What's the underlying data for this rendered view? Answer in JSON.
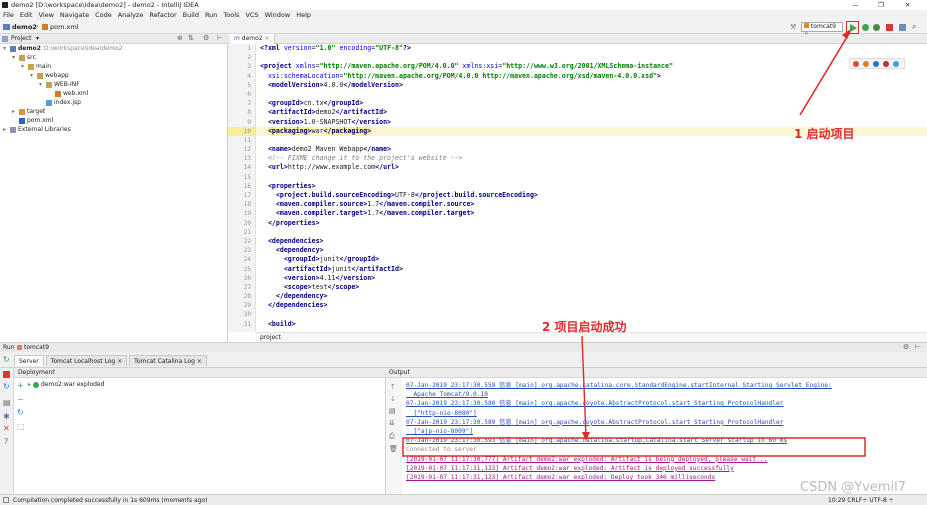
{
  "window": {
    "title": "demo2 [D:\\workspace\\idea\\demo2] - demo2 - IntelliJ IDEA",
    "controls": [
      "—",
      "❐",
      "✕"
    ]
  },
  "menu": [
    "File",
    "Edit",
    "View",
    "Navigate",
    "Code",
    "Analyze",
    "Refactor",
    "Build",
    "Run",
    "Tools",
    "VCS",
    "Window",
    "Help"
  ],
  "nav": {
    "crumbs": [
      "demo2",
      "pom.xml"
    ],
    "run_config": "tomcat9"
  },
  "project": {
    "header": "Project",
    "tree": [
      {
        "label": "demo2",
        "path": "D:\\workspace\\idea\\demo2",
        "indent": 0,
        "kind": "module",
        "open": true
      },
      {
        "label": "src",
        "indent": 1,
        "kind": "folder",
        "open": true
      },
      {
        "label": "main",
        "indent": 2,
        "kind": "folder",
        "open": true
      },
      {
        "label": "webapp",
        "indent": 3,
        "kind": "folder",
        "open": true
      },
      {
        "label": "WEB-INF",
        "indent": 4,
        "kind": "folder",
        "open": true
      },
      {
        "label": "web.xml",
        "indent": 5,
        "kind": "xml"
      },
      {
        "label": "index.jsp",
        "indent": 4,
        "kind": "jsp"
      },
      {
        "label": "target",
        "indent": 1,
        "kind": "target",
        "open": false
      },
      {
        "label": "pom.xml",
        "indent": 1,
        "kind": "pom"
      },
      {
        "label": "External Libraries",
        "indent": 0,
        "kind": "lib",
        "open": false
      }
    ]
  },
  "editor": {
    "tab": "demo2",
    "breadcrumb": "project",
    "lines": [
      {
        "n": "1",
        "html": "<span class='tag'>&lt;?xml </span><span class='attr'>version</span>=<span class='val'>\"1.0\"</span> <span class='attr'>encoding</span>=<span class='val'>\"UTF-8\"</span><span class='tag'>?&gt;</span>"
      },
      {
        "n": "2",
        "html": ""
      },
      {
        "n": "3",
        "html": "<span class='tag'>&lt;project </span><span class='attr'>xmlns</span>=<span class='val'>\"http://maven.apache.org/POM/4.0.0\"</span> <span class='attr'>xmlns:xsi</span>=<span class='val'>\"http://www.w3.org/2001/XMLSchema-instance\"</span>"
      },
      {
        "n": "4",
        "html": "  <span class='attr'>xsi:schemaLocation</span>=<span class='val'>\"http://maven.apache.org/POM/4.0.0 http://maven.apache.org/xsd/maven-4.0.0.xsd\"</span><span class='tag'>&gt;</span>"
      },
      {
        "n": "5",
        "html": "  <span class='tag'>&lt;modelVersion&gt;</span>4.0.0<span class='tag'>&lt;/modelVersion&gt;</span>"
      },
      {
        "n": "6",
        "html": ""
      },
      {
        "n": "7",
        "html": "  <span class='tag'>&lt;groupId&gt;</span>cn.tx<span class='tag'>&lt;/groupId&gt;</span>"
      },
      {
        "n": "8",
        "html": "  <span class='tag'>&lt;artifactId&gt;</span>demo2<span class='tag'>&lt;/artifactId&gt;</span>"
      },
      {
        "n": "9",
        "html": "  <span class='tag'>&lt;version&gt;</span>1.0-SNAPSHOT<span class='tag'>&lt;/version&gt;</span>"
      },
      {
        "n": "10",
        "html": "  <span class='tag hl'>&lt;packaging&gt;</span>war<span class='tag hl'>&lt;/packaging&gt;</span>",
        "hl": true
      },
      {
        "n": "11",
        "html": ""
      },
      {
        "n": "12",
        "html": "  <span class='tag'>&lt;name&gt;</span>demo2 Maven Webapp<span class='tag'>&lt;/name&gt;</span>"
      },
      {
        "n": "13",
        "html": "  <span class='cm'>&lt;!-- FIXME change it to the project's website --&gt;</span>"
      },
      {
        "n": "14",
        "html": "  <span class='tag'>&lt;url&gt;</span>http://www.example.com<span class='tag'>&lt;/url&gt;</span>"
      },
      {
        "n": "15",
        "html": ""
      },
      {
        "n": "16",
        "html": "  <span class='tag'>&lt;properties&gt;</span>"
      },
      {
        "n": "17",
        "html": "    <span class='tag'>&lt;project.build.sourceEncoding&gt;</span>UTF-8<span class='tag'>&lt;/project.build.sourceEncoding&gt;</span>"
      },
      {
        "n": "18",
        "html": "    <span class='tag'>&lt;maven.compiler.source&gt;</span>1.7<span class='tag'>&lt;/maven.compiler.source&gt;</span>"
      },
      {
        "n": "19",
        "html": "    <span class='tag'>&lt;maven.compiler.target&gt;</span>1.7<span class='tag'>&lt;/maven.compiler.target&gt;</span>"
      },
      {
        "n": "20",
        "html": "  <span class='tag'>&lt;/properties&gt;</span>"
      },
      {
        "n": "21",
        "html": ""
      },
      {
        "n": "22",
        "html": "  <span class='tag'>&lt;dependencies&gt;</span>"
      },
      {
        "n": "23",
        "html": "    <span class='tag'>&lt;dependency&gt;</span>"
      },
      {
        "n": "24",
        "html": "      <span class='tag'>&lt;groupId&gt;</span>junit<span class='tag'>&lt;/groupId&gt;</span>"
      },
      {
        "n": "25",
        "html": "      <span class='tag'>&lt;artifactId&gt;</span>junit<span class='tag'>&lt;/artifactId&gt;</span>"
      },
      {
        "n": "26",
        "html": "      <span class='tag'>&lt;version&gt;</span>4.11<span class='tag'>&lt;/version&gt;</span>"
      },
      {
        "n": "27",
        "html": "      <span class='tag'>&lt;scope&gt;</span>test<span class='tag'>&lt;/scope&gt;</span>"
      },
      {
        "n": "28",
        "html": "    <span class='tag'>&lt;/dependency&gt;</span>"
      },
      {
        "n": "29",
        "html": "  <span class='tag'>&lt;/dependencies&gt;</span>"
      },
      {
        "n": "30",
        "html": ""
      },
      {
        "n": "31",
        "html": "  <span class='tag'>&lt;build&gt;</span>"
      }
    ]
  },
  "run": {
    "title": "Run",
    "config": "tomcat9",
    "tabs": [
      "Server",
      "Tomcat Localhost Log",
      "Tomcat Catalina Log"
    ],
    "deployment_header": "Deployment",
    "deployment_item": "demo2:war exploded",
    "output_header": "Output",
    "log": [
      {
        "t": "07-Jan-2019 23:17:30.559 信息 [main] org.apache.catalina.core.StandardEngine.startInternal Starting Servlet Engine:",
        "c": "blue"
      },
      {
        "t": "  Apache Tomcat/9.0.10",
        "c": "blue"
      },
      {
        "t": "07-Jan-2019 23:17:30.580 信息 [main] org.apache.coyote.AbstractProtocol.start Starting ProtocolHandler",
        "c": "blue"
      },
      {
        "t": "  [\"http-nio-8080\"]",
        "c": "blue"
      },
      {
        "t": "07-Jan-2019 23:17:30.589 信息 [main] org.apache.coyote.AbstractProtocol.start Starting ProtocolHandler",
        "c": "blue"
      },
      {
        "t": "  [\"ajp-nio-8009\"]",
        "c": "blue"
      },
      {
        "t": "07-Jan-2019 23:17:30.593 信息 [main] org.apache.catalina.startup.Catalina.start Server startup in 60 ms",
        "c": "blue"
      },
      {
        "t": "Connected to server",
        "c": "grey"
      },
      {
        "t": "[2019-01-07 11:17:30,777] Artifact demo2:war exploded: Artifact is being deployed, please wait...",
        "c": "mag"
      },
      {
        "t": "[2019-01-07 11:17:31,123] Artifact demo2:war exploded: Artifact is deployed successfully",
        "c": "mag"
      },
      {
        "t": "[2019-01-07 11:17:31,123] Artifact demo2:war exploded: Deploy took 346 milliseconds",
        "c": "mag"
      }
    ]
  },
  "status": {
    "message": "Compilation completed successfully in 1s 609ms (moments ago)",
    "right": "10:29  CRLF÷  UTF-8 ÷"
  },
  "annotations": {
    "a1": "1 启动项目",
    "a2": "2  项目启动成功",
    "watermark": "CSDN @Yvemil7"
  },
  "colors": {
    "accent_red": "#e02a2a",
    "run_green": "#3aa84a"
  }
}
